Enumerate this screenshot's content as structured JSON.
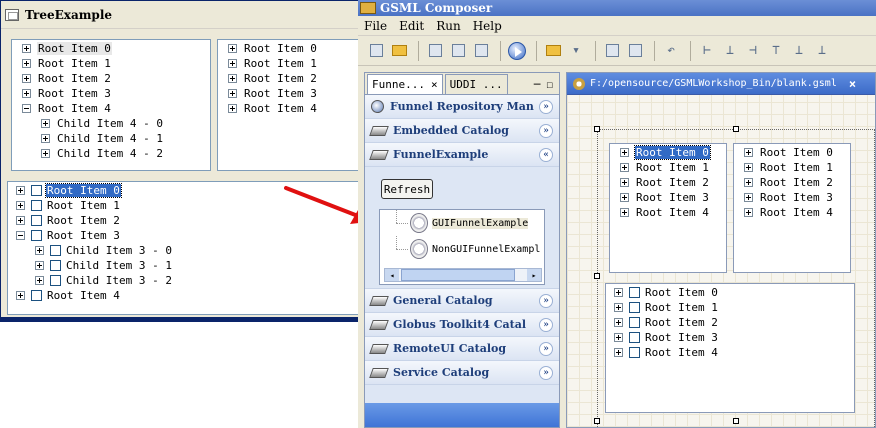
{
  "tree_example": {
    "title": "TreeExample",
    "top_left_tree": [
      {
        "label": "Root Item 0",
        "expander": "plus",
        "level": 0,
        "hover": true
      },
      {
        "label": "Root Item 1",
        "expander": "plus",
        "level": 0
      },
      {
        "label": "Root Item 2",
        "expander": "plus",
        "level": 0
      },
      {
        "label": "Root Item 3",
        "expander": "plus",
        "level": 0
      },
      {
        "label": "Root Item 4",
        "expander": "minus",
        "level": 0
      },
      {
        "label": "Child Item 4 - 0",
        "expander": "plus",
        "level": 1
      },
      {
        "label": "Child Item 4 - 1",
        "expander": "plus",
        "level": 1
      },
      {
        "label": "Child Item 4 - 2",
        "expander": "plus",
        "level": 1
      }
    ],
    "top_right_tree": [
      "Root Item 0",
      "Root Item 1",
      "Root Item 2",
      "Root Item 3",
      "Root Item 4"
    ],
    "check_tree": [
      {
        "label": "Root Item 0",
        "expander": "plus",
        "level": 0,
        "selected": true
      },
      {
        "label": "Root Item 1",
        "expander": "plus",
        "level": 0
      },
      {
        "label": "Root Item 2",
        "expander": "plus",
        "level": 0
      },
      {
        "label": "Root Item 3",
        "expander": "minus",
        "level": 0
      },
      {
        "label": "Child Item 3 - 0",
        "expander": "plus",
        "level": 1
      },
      {
        "label": "Child Item 3 - 1",
        "expander": "plus",
        "level": 1
      },
      {
        "label": "Child Item 3 - 2",
        "expander": "plus",
        "level": 1
      },
      {
        "label": "Root Item 4",
        "expander": "plus",
        "level": 0
      }
    ]
  },
  "gsml": {
    "title": "GSML Composer",
    "menu": [
      "File",
      "Edit",
      "Run",
      "Help"
    ],
    "palette_tabs": [
      {
        "label": "Funne...",
        "active": true,
        "close": "×"
      },
      {
        "label": "UDDI ...",
        "active": false
      }
    ],
    "palette_controls": [
      "─",
      "☐"
    ],
    "drawers_top": [
      {
        "label": "Funnel Repository Man",
        "icon": "globe-icon",
        "chevron": "»"
      },
      {
        "label": "Embedded Catalog",
        "icon": "chip-icon",
        "chevron": "»"
      },
      {
        "label": "FunnelExample",
        "icon": "chip-icon",
        "chevron": "«"
      }
    ],
    "refresh_label": "Refresh",
    "funnels": [
      "GUIFunnelExample",
      "NonGUIFunnelExampl"
    ],
    "drawers_bottom": [
      {
        "label": "General Catalog",
        "chevron": "»"
      },
      {
        "label": "Globus Toolkit4 Catal",
        "chevron": "»"
      },
      {
        "label": "RemoteUI Catalog",
        "chevron": "»"
      },
      {
        "label": "Service Catalog",
        "chevron": "»"
      }
    ],
    "editor_tab": {
      "label": "F:/opensource/GSMLWorkshop_Bin/blank.gsml",
      "close": "×"
    },
    "design_tree_left": [
      "Root Item 0",
      "Root Item 1",
      "Root Item 2",
      "Root Item 3",
      "Root Item 4"
    ],
    "design_tree_right": [
      "Root Item 0",
      "Root Item 1",
      "Root Item 2",
      "Root Item 3",
      "Root Item 4"
    ],
    "design_check_tree": [
      "Root Item 0",
      "Root Item 1",
      "Root Item 2",
      "Root Item 3",
      "Root Item 4"
    ]
  },
  "colors": {
    "arrow": "#e01010",
    "selection": "#316ac5",
    "title_bar": "#4a72c4"
  }
}
